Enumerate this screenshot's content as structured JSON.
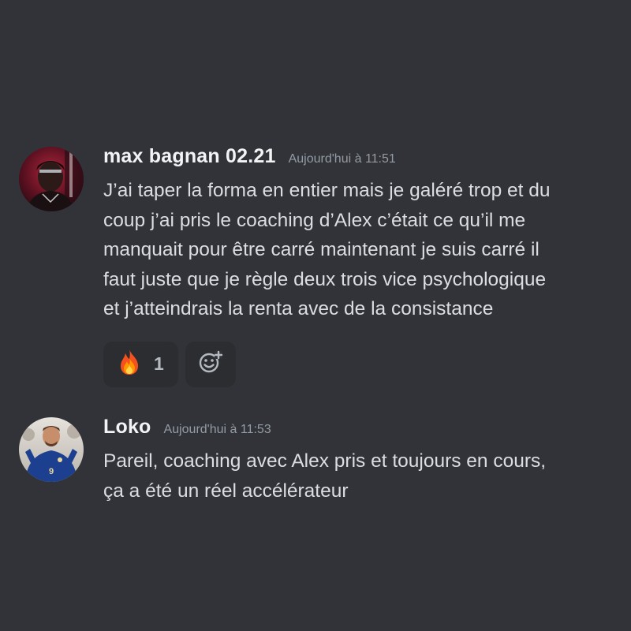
{
  "messages": [
    {
      "username": "max bagnan 02.21",
      "timestamp": "Aujourd'hui à 11:51",
      "avatar_icon": "user-avatar",
      "lines": [
        "J’ai taper la forma en entier mais je galéré trop et du",
        "coup j’ai pris le coaching d’Alex c’était ce qu’il me",
        "manquait pour être carré maintenant je suis carré il",
        "faut juste que je règle deux trois vice psychologique",
        "et j’atteindrais la renta avec de la consistance"
      ],
      "reactions": [
        {
          "emoji_icon": "fire-emoji-icon",
          "count": "1"
        }
      ],
      "add_reaction_icon": "add-reaction-icon"
    },
    {
      "username": "Loko",
      "timestamp": "Aujourd'hui à 11:53",
      "avatar_icon": "user-avatar",
      "lines": [
        "Pareil, coaching avec Alex pris et toujours en cours,",
        "ça a été un réel accélérateur"
      ]
    }
  ],
  "colors": {
    "background": "#313338",
    "username": "#f2f3f5",
    "timestamp": "#949ba4",
    "text": "#dbdee1",
    "reaction_bg": "#2b2d31"
  }
}
